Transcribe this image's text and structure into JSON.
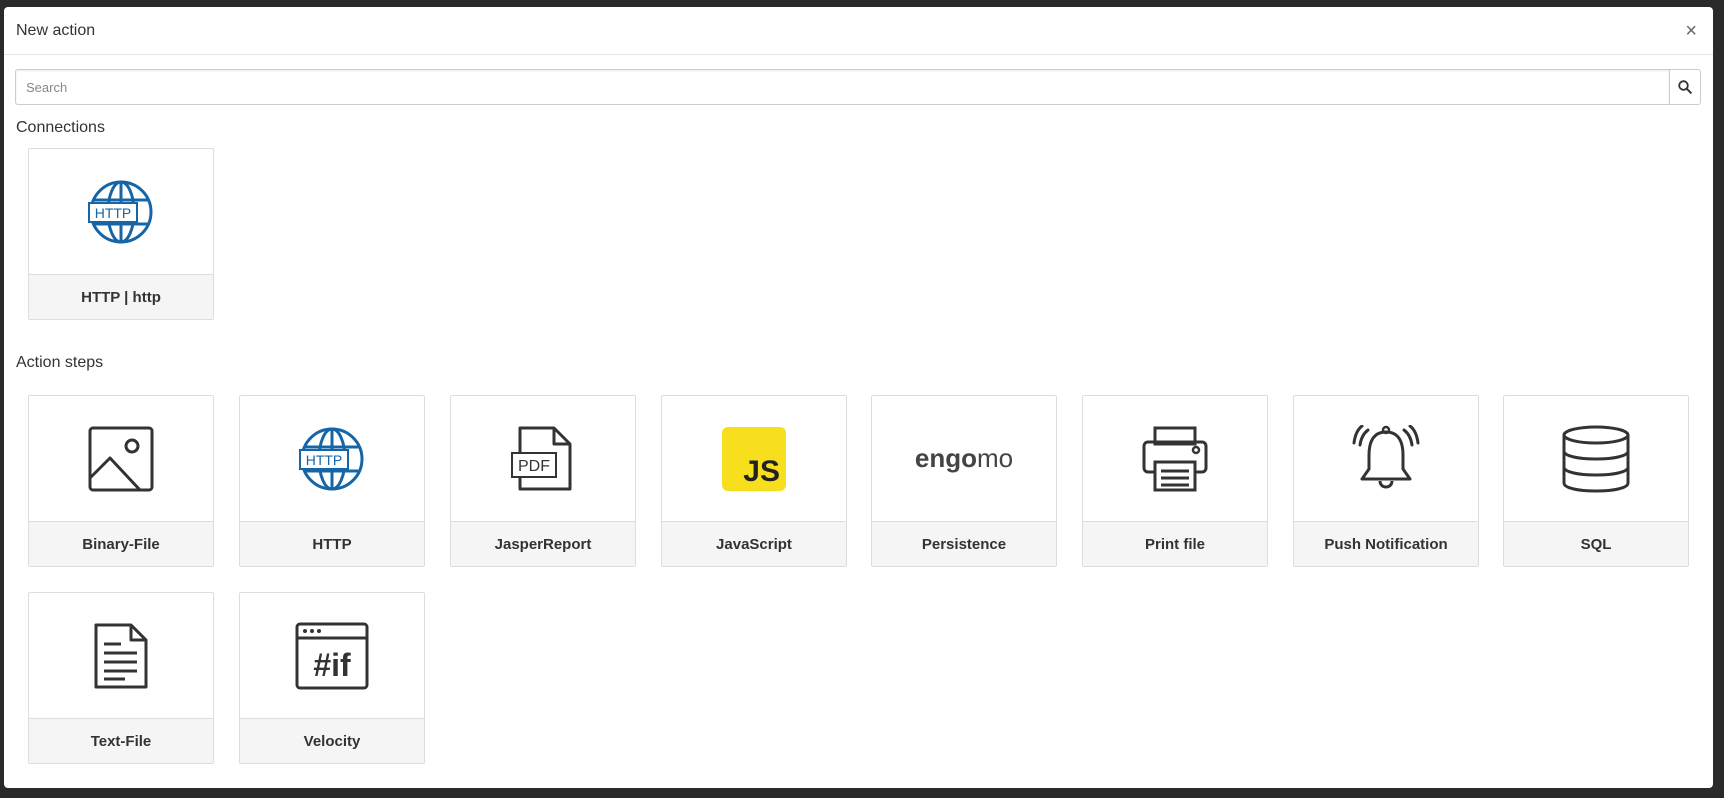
{
  "dialog": {
    "title": "New action",
    "close_label": "×"
  },
  "search": {
    "placeholder": "Search",
    "value": ""
  },
  "sections": {
    "connections": {
      "title": "Connections",
      "items": [
        {
          "label": "HTTP | http",
          "icon": "http-globe-icon"
        }
      ]
    },
    "action_steps": {
      "title": "Action steps",
      "items": [
        {
          "label": "Binary-File",
          "icon": "image-icon"
        },
        {
          "label": "HTTP",
          "icon": "http-globe-icon"
        },
        {
          "label": "JasperReport",
          "icon": "pdf-file-icon"
        },
        {
          "label": "JavaScript",
          "icon": "js-logo-icon",
          "icon_text": "JS"
        },
        {
          "label": "Persistence",
          "icon": "engomo-logo-icon",
          "logo_text_a": "engo",
          "logo_text_b": "mo"
        },
        {
          "label": "Print file",
          "icon": "printer-icon"
        },
        {
          "label": "Push Notification",
          "icon": "bell-icon"
        },
        {
          "label": "SQL",
          "icon": "database-icon"
        },
        {
          "label": "Text-File",
          "icon": "text-file-icon"
        },
        {
          "label": "Velocity",
          "icon": "velocity-template-icon",
          "icon_text": "#if"
        }
      ]
    }
  },
  "icon_text": {
    "http": "HTTP",
    "pdf": "PDF"
  },
  "colors": {
    "http_blue": "#1565a7",
    "js_yellow": "#f7df1e",
    "icon_dark": "#333333"
  }
}
